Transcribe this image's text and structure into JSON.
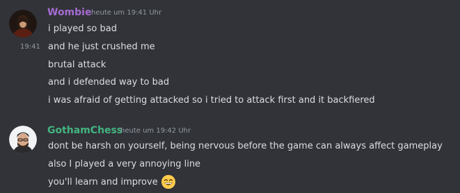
{
  "messages": [
    {
      "author": "Wombie",
      "author_color": "#a66bd3",
      "timestamp": "heute um 19:41 Uhr",
      "hover_time": "19:41",
      "lines": [
        "i played so bad",
        "and he just crushed me",
        "brutal attack",
        "and i defended way to bad",
        "i was afraid of getting attacked so i tried to attack first and it backfiered"
      ]
    },
    {
      "author": "GothamChess",
      "author_color": "#43b581",
      "timestamp": "heute um 19:42 Uhr",
      "lines": [
        "dont be harsh on yourself, being nervous before the game can always affect gameplay",
        "also I played a very annoying line",
        "you'll learn and improve"
      ],
      "emoji": "grinning-face-with-smiling-eyes"
    }
  ]
}
